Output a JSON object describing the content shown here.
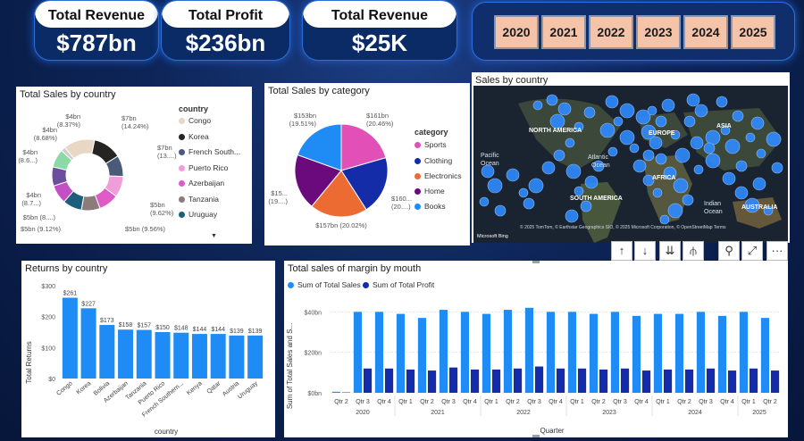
{
  "kpis": [
    {
      "label": "Total Revenue",
      "value": "$787bn"
    },
    {
      "label": "Total Profit",
      "value": "$236bn"
    },
    {
      "label": "Total Revenue",
      "value": "$25K"
    }
  ],
  "years": [
    "2020",
    "2021",
    "2022",
    "2023",
    "2024",
    "2025"
  ],
  "sales_by_country": {
    "title": "Total Sales by country",
    "legend_title": "country",
    "legend": [
      "Congo",
      "Korea",
      "French South...",
      "Puerto Rico",
      "Azerbaijan",
      "Tanzania",
      "Uruguay"
    ],
    "slice_labels": [
      "$7bn",
      "(14.24%)",
      "$7bn",
      "(13....)",
      "$5bn",
      "(9.62%)",
      "$5bn (9.56%)",
      "$5bn (9.12%)",
      "$5bn (8....)",
      "$4bn",
      "(8.7...)",
      "$4bn",
      "(8.6...)",
      "$4bn",
      "(8.68%)",
      "$4bn",
      "(8.37%)"
    ]
  },
  "sales_by_category": {
    "title": "Total Sales by category",
    "legend_title": "category",
    "legend": [
      "Sports",
      "Clothing",
      "Electronics",
      "Home",
      "Books"
    ],
    "slice_labels": [
      "$161bn",
      "(20.46%)",
      "$160...",
      "(20....)",
      "$157bn (20.02%)",
      "$15...",
      "(19....)",
      "$153bn",
      "(19.51%)"
    ]
  },
  "map": {
    "title": "Sales by country",
    "labels": [
      "NORTH AMERICA",
      "Pacific",
      "Ocean",
      "Atlantic",
      "Ocean",
      "EUROPE",
      "ASIA",
      "AFRICA",
      "SOUTH AMERICA",
      "Indian",
      "Ocean",
      "AUSTRALIA"
    ],
    "footer_brand": "Microsoft Bing",
    "footer_credits": "© 2025 TomTom, © Earthstar Geographics SIO, © 2025 Microsoft Corporation, © OpenStreetMap  Terms"
  },
  "toolbar": {
    "icons": [
      "arrow-up-icon",
      "arrow-down-icon",
      "double-arrow-down-icon",
      "expand-hierarchy-icon",
      "filter-icon",
      "focus-mode-icon",
      "more-options-icon"
    ],
    "glyphs": [
      "↑",
      "↓",
      "⇊",
      "⫛",
      "⚲",
      "⤢",
      "···"
    ]
  },
  "chart_data": [
    {
      "type": "pie",
      "title": "Total Sales by country",
      "categories": [
        "Congo",
        "Korea",
        "French South...",
        "Puerto Rico",
        "Azerbaijan",
        "Tanzania",
        "Uruguay",
        "",
        "",
        "",
        ""
      ],
      "values": [
        14.24,
        13.0,
        9.62,
        9.56,
        9.12,
        8.5,
        8.7,
        8.6,
        8.68,
        8.37,
        2.0
      ],
      "colors": [
        "#e8d7c4",
        "#252423",
        "#4a5a7a",
        "#f29ddb",
        "#dd5cc7",
        "#8c7b7b",
        "#1d5e7a",
        "#c44fc4",
        "#6b4e9e",
        "#8bd9a4",
        "#cccccc"
      ],
      "legend_title": "country"
    },
    {
      "type": "pie",
      "title": "Total Sales by category",
      "categories": [
        "Sports",
        "Clothing",
        "Electronics",
        "Home",
        "Books"
      ],
      "values": [
        161,
        160,
        157,
        153,
        153
      ],
      "colors": [
        "#e24fb7",
        "#142ca8",
        "#eb6b33",
        "#6a0a7d",
        "#1f8cf5"
      ],
      "legend_title": "category"
    },
    {
      "type": "bar",
      "title": "Returns by country",
      "categories": [
        "Congo",
        "Korea",
        "Bolivia",
        "Azerbaijan",
        "Tanzania",
        "Puerto Rico",
        "French Southern...",
        "Kenya",
        "Qatar",
        "Austria",
        "Uruguay"
      ],
      "values": [
        261,
        227,
        173,
        158,
        157,
        150,
        148,
        144,
        144,
        139,
        139
      ],
      "data_labels": [
        "$261",
        "$227",
        "$173",
        "$158",
        "$157",
        "$150",
        "$148",
        "$144",
        "$144",
        "$139",
        "$139"
      ],
      "y_ticks": [
        "$300",
        "$200",
        "$100",
        "$0"
      ],
      "ylim": [
        0,
        300
      ],
      "xlabel": "country",
      "ylabel": "Total Returns",
      "color": "#1f8cf5"
    },
    {
      "type": "bar",
      "title": "Total sales of margin by mouth",
      "categories": [
        "Qtr 2",
        "Qtr 3",
        "Qtr 4",
        "Qtr 1",
        "Qtr 2",
        "Qtr 3",
        "Qtr 4",
        "Qtr 1",
        "Qtr 2",
        "Qtr 3",
        "Qtr 4",
        "Qtr 1",
        "Qtr 2",
        "Qtr 3",
        "Qtr 4",
        "Qtr 1",
        "Qtr 2",
        "Qtr 3",
        "Qtr 4",
        "Qtr 1",
        "Qtr 2"
      ],
      "year_groups": [
        {
          "label": "2020",
          "start": 0,
          "end": 2
        },
        {
          "label": "2021",
          "start": 3,
          "end": 6
        },
        {
          "label": "2022",
          "start": 7,
          "end": 10
        },
        {
          "label": "2023",
          "start": 11,
          "end": 14
        },
        {
          "label": "2024",
          "start": 15,
          "end": 18
        },
        {
          "label": "2025",
          "start": 19,
          "end": 20
        }
      ],
      "series": [
        {
          "name": "Sum of Total Sales",
          "color": "#1f8cf5",
          "values": [
            0.5,
            40,
            40,
            39,
            37,
            41,
            40,
            39,
            41,
            42,
            40,
            40,
            39,
            40,
            38,
            39,
            39,
            40,
            38,
            40,
            37
          ]
        },
        {
          "name": "Sum of Total Profit",
          "color": "#142ca8",
          "values": [
            0.2,
            12,
            12,
            11.5,
            11,
            12.5,
            11.5,
            11.5,
            12,
            13,
            12,
            12,
            11.5,
            12,
            11,
            11.5,
            11.5,
            12,
            11,
            12,
            11
          ]
        }
      ],
      "y_ticks": [
        "$40bn",
        "$20bn",
        "$0bn"
      ],
      "ylim": [
        0,
        45
      ],
      "xlabel": "Quarter",
      "ylabel": "Sum of Total Sales and S..."
    }
  ]
}
